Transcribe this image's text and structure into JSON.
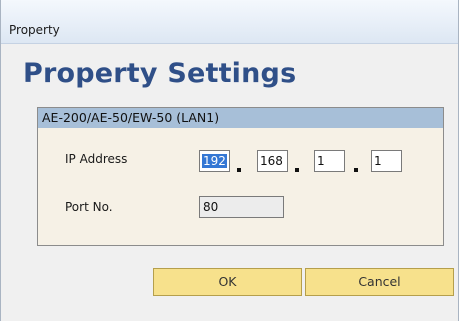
{
  "window": {
    "title": "Property"
  },
  "heading": "Property Settings",
  "group": {
    "title": "AE-200/AE-50/EW-50 (LAN1)",
    "ip_label": "IP Address",
    "ip_octets": [
      "192",
      "168",
      "1",
      "1"
    ],
    "port_label": "Port No.",
    "port_value": "80"
  },
  "buttons": {
    "ok": "OK",
    "cancel": "Cancel"
  },
  "colors": {
    "heading": "#2f4f88",
    "group_header": "#a7bfd8",
    "group_background": "#f6f1e6",
    "button": "#f7e18c",
    "selection": "#3477d4"
  }
}
